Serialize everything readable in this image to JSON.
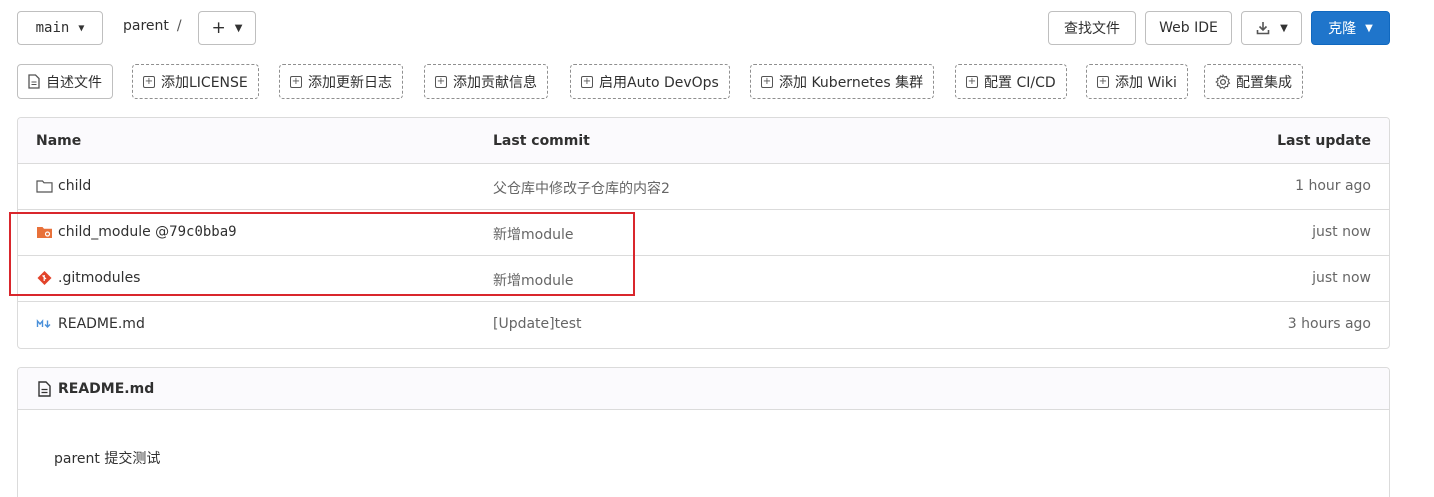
{
  "toolbar": {
    "branch": "main",
    "breadcrumb": "parent",
    "breadcrumb_sep": "/",
    "add_label": "+",
    "find_file": "查找文件",
    "web_ide": "Web IDE",
    "download_icon": "download-icon",
    "clone": "克隆"
  },
  "quick_actions": [
    {
      "label": "自述文件",
      "icon": "file-icon"
    },
    {
      "label": "添加LICENSE",
      "icon": "plus-square-icon"
    },
    {
      "label": "添加更新日志",
      "icon": "plus-square-icon"
    },
    {
      "label": "添加贡献信息",
      "icon": "plus-square-icon"
    },
    {
      "label": "启用Auto DevOps",
      "icon": "plus-square-icon"
    },
    {
      "label": "添加 Kubernetes 集群",
      "icon": "plus-square-icon"
    },
    {
      "label": "配置 CI/CD",
      "icon": "plus-square-icon"
    },
    {
      "label": "添加 Wiki",
      "icon": "plus-square-icon"
    },
    {
      "label": "配置集成",
      "icon": "gear-icon"
    }
  ],
  "table": {
    "headers": {
      "name": "Name",
      "last_commit": "Last commit",
      "last_update": "Last update"
    },
    "rows": [
      {
        "name": "child",
        "icon": "folder-icon",
        "commit": "父仓库中修改子仓库的内容2",
        "time": "1 hour ago"
      },
      {
        "name": "child_module @ ",
        "ref": "79c0bba9",
        "icon": "submodule-folder-icon",
        "commit": "新增module",
        "time": "just now"
      },
      {
        "name": ".gitmodules",
        "icon": "git-icon",
        "commit": "新增module",
        "time": "just now"
      },
      {
        "name": "README.md",
        "icon": "markdown-icon",
        "commit": "[Update]test",
        "time": "3 hours ago"
      }
    ]
  },
  "readme": {
    "title": "README.md",
    "body": "parent 提交测试"
  },
  "colors": {
    "accent": "#1f75cb",
    "highlight_box": "#d9262c",
    "submodule_icon": "#e8713a",
    "git_icon": "#e2432a",
    "markdown_icon": "#4a90d9"
  }
}
